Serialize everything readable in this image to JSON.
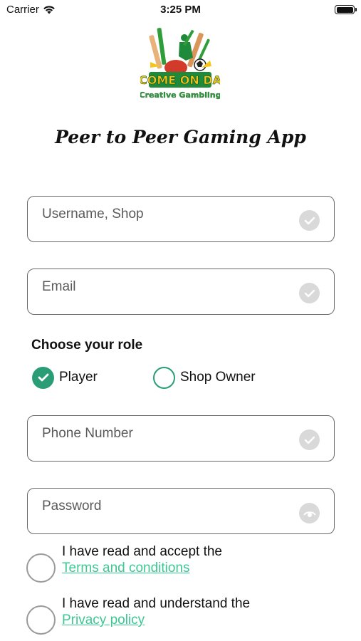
{
  "status_bar": {
    "carrier": "Carrier",
    "time": "3:25 PM"
  },
  "logo": {
    "line1": "COME ON DA",
    "line2": "Creative Gambling"
  },
  "title": "Peer to Peer Gaming App",
  "form": {
    "username_placeholder": "Username, Shop",
    "email_placeholder": "Email",
    "role_label": "Choose your role",
    "roles": [
      {
        "label": "Player",
        "selected": true
      },
      {
        "label": "Shop Owner",
        "selected": false
      }
    ],
    "phone_placeholder": "Phone Number",
    "password_placeholder": "Password"
  },
  "agreements": {
    "terms_text": "I have read and accept the",
    "terms_link": "Terms and conditions",
    "privacy_text": "I have read and understand the",
    "privacy_link": "Privacy policy"
  },
  "colors": {
    "accent": "#2a9d76",
    "link": "#3cc793",
    "field_border": "#6a6a6a",
    "check_bg": "#d9d9d9"
  },
  "icons": {
    "signal": "wifi-icon",
    "battery": "battery-icon",
    "valid": "check-icon",
    "password_toggle": "eye-icon"
  }
}
